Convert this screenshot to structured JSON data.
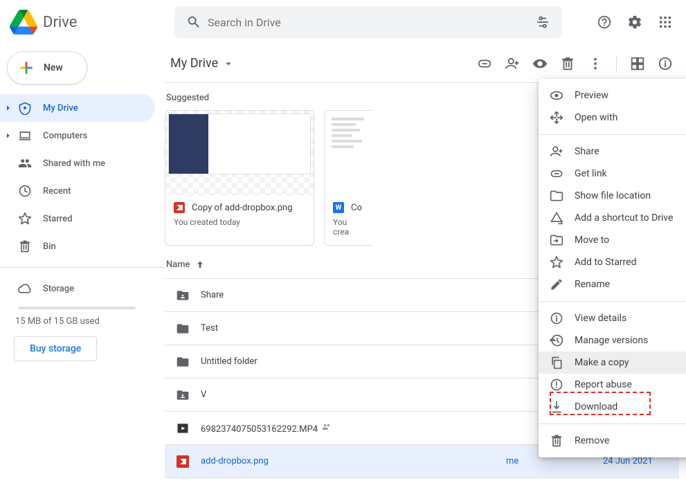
{
  "header": {
    "app_title": "Drive",
    "search_placeholder": "Search in Drive"
  },
  "new_button_label": "New",
  "sidebar": {
    "items": [
      {
        "label": "My Drive"
      },
      {
        "label": "Computers"
      },
      {
        "label": "Shared with me"
      },
      {
        "label": "Recent"
      },
      {
        "label": "Starred"
      },
      {
        "label": "Bin"
      }
    ],
    "storage_label": "Storage",
    "storage_used": "15 MB of 15 GB used",
    "buy_label": "Buy storage"
  },
  "toolbar": {
    "breadcrumb": "My Drive"
  },
  "suggested_heading": "Suggested",
  "cards": [
    {
      "title": "Copy of add-dropbox.png",
      "sub": "You created today",
      "badge": "img"
    },
    {
      "title": "Co",
      "sub": "You crea",
      "badge": "doc",
      "doc_letter": "W"
    }
  ],
  "columns": {
    "name": "Name"
  },
  "rows": [
    {
      "type": "folder_shared",
      "name": "Share"
    },
    {
      "type": "folder",
      "name": "Test"
    },
    {
      "type": "folder",
      "name": "Untitled folder"
    },
    {
      "type": "folder_shared",
      "name": "V"
    },
    {
      "type": "video",
      "name": "6982374075053162292.MP4",
      "shared": true
    },
    {
      "type": "image",
      "name": "add-dropbox.png",
      "owner": "me",
      "modified": "24 Jun 2021",
      "selected": true,
      "ending": "x"
    }
  ],
  "context_menu": {
    "groups": [
      [
        {
          "id": "preview",
          "label": "Preview"
        },
        {
          "id": "open-with",
          "label": "Open with",
          "submenu": true
        }
      ],
      [
        {
          "id": "share",
          "label": "Share"
        },
        {
          "id": "get-link",
          "label": "Get link"
        },
        {
          "id": "show-file-location",
          "label": "Show file location"
        },
        {
          "id": "add-shortcut",
          "label": "Add a shortcut to Drive",
          "help": true
        },
        {
          "id": "move-to",
          "label": "Move to"
        },
        {
          "id": "add-to-starred",
          "label": "Add to Starred"
        },
        {
          "id": "rename",
          "label": "Rename"
        }
      ],
      [
        {
          "id": "view-details",
          "label": "View details"
        },
        {
          "id": "manage-versions",
          "label": "Manage versions"
        },
        {
          "id": "make-a-copy",
          "label": "Make a copy",
          "highlighted": true
        },
        {
          "id": "report-abuse",
          "label": "Report abuse"
        },
        {
          "id": "download",
          "label": "Download"
        }
      ],
      [
        {
          "id": "remove",
          "label": "Remove"
        }
      ]
    ]
  }
}
